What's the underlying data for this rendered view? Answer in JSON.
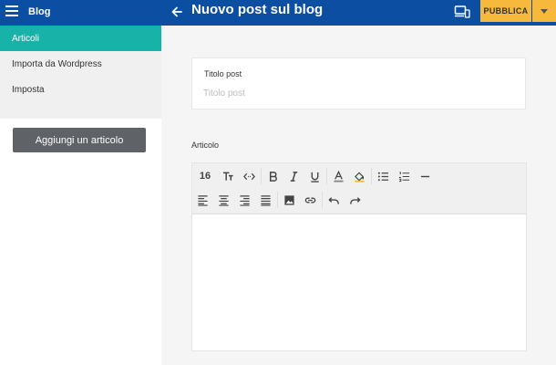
{
  "header": {
    "app_title": "Blog",
    "page_title": "Nuovo post sul blog",
    "publish_label": "PUBBLICA",
    "accent": "#0b4ea2",
    "publish_color": "#f6b93b"
  },
  "sidebar": {
    "items": [
      {
        "label": "Articoli",
        "active": true
      },
      {
        "label": "Importa da Wordpress",
        "active": false
      },
      {
        "label": "Imposta",
        "active": false
      }
    ],
    "add_button_label": "Aggiungi un articolo",
    "active_color": "#17b3a8"
  },
  "form": {
    "title_label": "Titolo post",
    "title_placeholder": "Titolo post",
    "title_value": "",
    "article_label": "Articolo"
  },
  "toolbar": {
    "font_size": "16",
    "icons_row1": [
      "text-size-icon",
      "code-icon",
      "bold-icon",
      "italic-icon",
      "underline-icon",
      "text-color-icon",
      "fill-color-icon",
      "bullet-list-icon",
      "numbered-list-icon",
      "horizontal-rule-icon"
    ],
    "icons_row2": [
      "align-left-icon",
      "align-center-icon",
      "align-right-icon",
      "align-justify-icon",
      "image-icon",
      "link-icon",
      "undo-icon",
      "redo-icon"
    ]
  }
}
